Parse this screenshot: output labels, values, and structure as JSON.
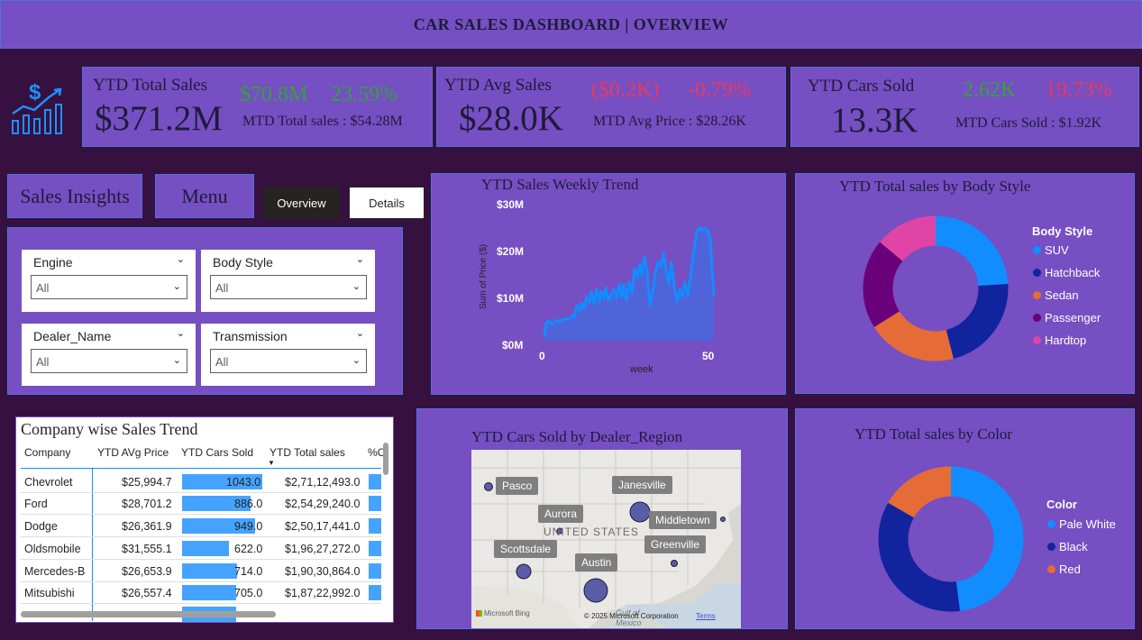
{
  "header": {
    "title": "CAR SALES DASHBOARD | OVERVIEW"
  },
  "kpis": {
    "total_sales": {
      "title": "YTD Total Sales",
      "value": "$371.2M",
      "delta_value": "$70.8M",
      "delta_pct": "23.59%",
      "mtd_label": "MTD Total sales : $54.28M"
    },
    "avg_sales": {
      "title": "YTD Avg Sales",
      "value": "$28.0K",
      "delta_value": "($0.2K)",
      "delta_pct": "-0.79%",
      "mtd_label": "MTD Avg Price : $28.26K"
    },
    "cars_sold": {
      "title": "YTD Cars Sold",
      "value": "13.3K",
      "delta_value": "2.62K",
      "delta_pct": "19.73%",
      "mtd_label": "MTD Cars Sold : $1.92K"
    }
  },
  "nav": {
    "insights": "Sales Insights",
    "menu": "Menu",
    "overview": "Overview",
    "details": "Details"
  },
  "slicers": [
    {
      "label": "Engine",
      "value": "All"
    },
    {
      "label": "Body Style",
      "value": "All"
    },
    {
      "label": "Dealer_Name",
      "value": "All"
    },
    {
      "label": "Transmission",
      "value": "All"
    }
  ],
  "weekly_trend": {
    "title": "YTD Sales Weekly Trend",
    "y_label": "Sum of Price ($)",
    "x_label": "week",
    "y_ticks": [
      "$30M",
      "$20M",
      "$10M",
      "$0M"
    ],
    "x_ticks": [
      "0",
      "50"
    ]
  },
  "body_style": {
    "title": "YTD Total sales by Body Style",
    "legend_title": "Body Style",
    "items": [
      {
        "label": "SUV",
        "color": "#118dff"
      },
      {
        "label": "Hatchback",
        "color": "#12239e"
      },
      {
        "label": "Sedan",
        "color": "#e66c37"
      },
      {
        "label": "Passenger",
        "color": "#6b007b"
      },
      {
        "label": "Hardtop",
        "color": "#e044a7"
      }
    ]
  },
  "color_chart": {
    "title": "YTD Total sales by Color",
    "legend_title": "Color",
    "items": [
      {
        "label": "Pale White",
        "color": "#118dff"
      },
      {
        "label": "Black",
        "color": "#12239e"
      },
      {
        "label": "Red",
        "color": "#e66c37"
      }
    ]
  },
  "map": {
    "title": "YTD Cars Sold by Dealer_Region",
    "country_label": "UNITED STATES",
    "gulf_label": "Gulf of",
    "mexico_label": "Mexico",
    "regions": [
      "Pasco",
      "Janesville",
      "Aurora",
      "Middletown",
      "Scottsdale",
      "Greenville",
      "Austin"
    ],
    "bing_label": "Microsoft Bing",
    "copyright": "© 2025 Microsoft Corporation",
    "terms": "Terms"
  },
  "table": {
    "title": "Company wise Sales Trend",
    "columns": [
      "Company",
      "YTD AVg Price",
      "YTD Cars Sold",
      "YTD Total sales",
      "%C"
    ],
    "rows": [
      {
        "company": "Chevrolet",
        "avg": "$25,994.7",
        "sold": "1043.0",
        "total": "$2,71,12,493.0"
      },
      {
        "company": "Ford",
        "avg": "$28,701.2",
        "sold": "886.0",
        "total": "$2,54,29,240.0"
      },
      {
        "company": "Dodge",
        "avg": "$26,361.9",
        "sold": "949.0",
        "total": "$2,50,17,441.0"
      },
      {
        "company": "Oldsmobile",
        "avg": "$31,555.1",
        "sold": "622.0",
        "total": "$1,96,27,272.0"
      },
      {
        "company": "Mercedes-B",
        "avg": "$26,653.9",
        "sold": "714.0",
        "total": "$1,90,30,864.0"
      },
      {
        "company": "Mitsubishi",
        "avg": "$26,557.4",
        "sold": "705.0",
        "total": "$1,87,22,992.0"
      }
    ]
  }
}
